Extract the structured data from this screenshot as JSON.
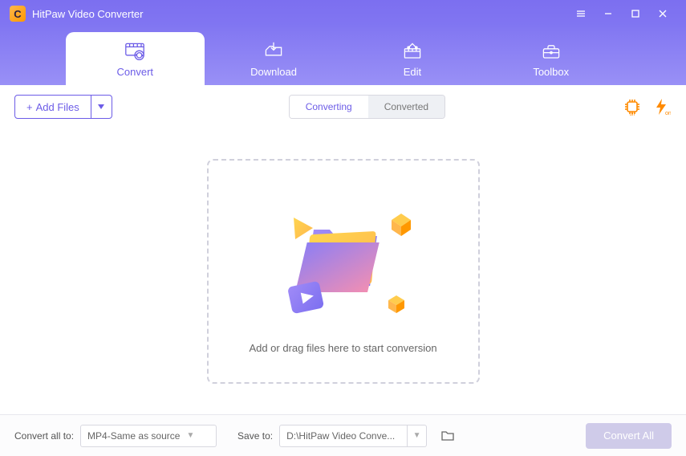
{
  "app": {
    "title": "HitPaw Video Converter",
    "logo_letter": "C"
  },
  "nav": {
    "tabs": [
      {
        "label": "Convert"
      },
      {
        "label": "Download"
      },
      {
        "label": "Edit"
      },
      {
        "label": "Toolbox"
      }
    ]
  },
  "toolbar": {
    "add_files_label": "Add Files",
    "segments": [
      {
        "label": "Converting"
      },
      {
        "label": "Converted"
      }
    ],
    "gpu_badge": "on",
    "lightning_badge": "on"
  },
  "dropzone": {
    "hint": "Add or drag files here to start conversion"
  },
  "footer": {
    "convert_all_to_label": "Convert all to:",
    "format_value": "MP4-Same as source",
    "save_to_label": "Save to:",
    "path_value": "D:\\HitPaw Video Conve...",
    "convert_all_btn": "Convert All"
  }
}
